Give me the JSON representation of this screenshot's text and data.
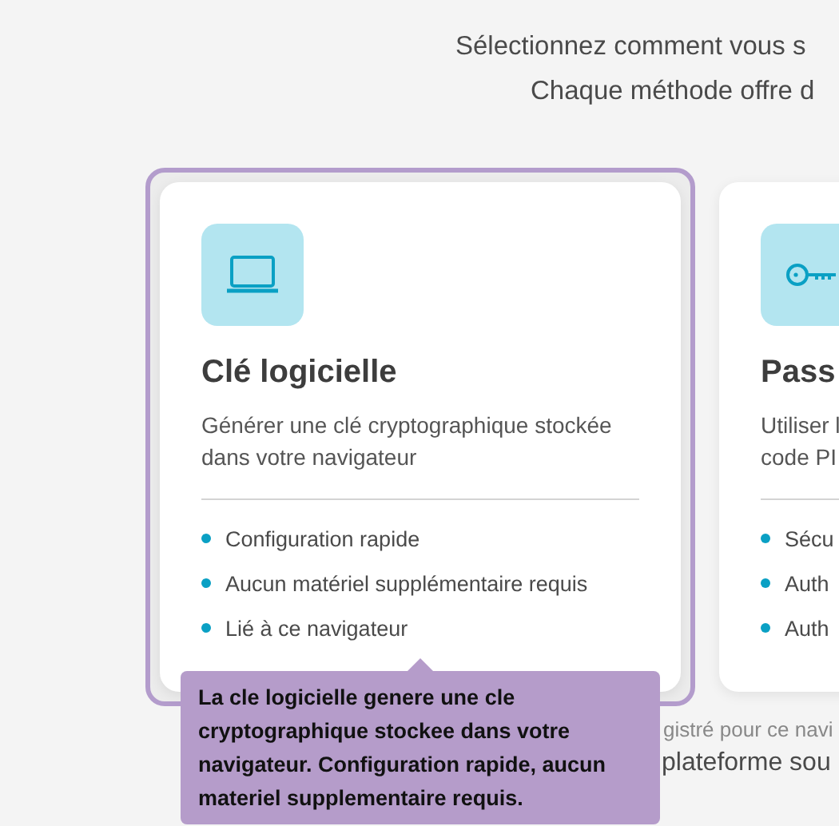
{
  "intro": [
    "Sélectionnez comment vous s",
    "Chaque méthode offre d"
  ],
  "cards": [
    {
      "selected": true,
      "title": "Clé logicielle",
      "description": "Générer une clé cryptographique stockée dans votre navigateur",
      "features": [
        "Configuration rapide",
        "Aucun matériel supplémentaire requis",
        "Lié à ce navigateur"
      ]
    },
    {
      "selected": false,
      "title": "Pass",
      "description": "Utiliser l\ncode PI",
      "features": [
        "Sécu",
        "Auth",
        "Auth"
      ]
    }
  ],
  "footer": [
    "gistré pour ce navi",
    "plateforme sou"
  ],
  "tooltip": "La cle logicielle genere une cle cryptographique stockee dans votre navigateur. Configuration rapide, aucun materiel supplementaire requis."
}
